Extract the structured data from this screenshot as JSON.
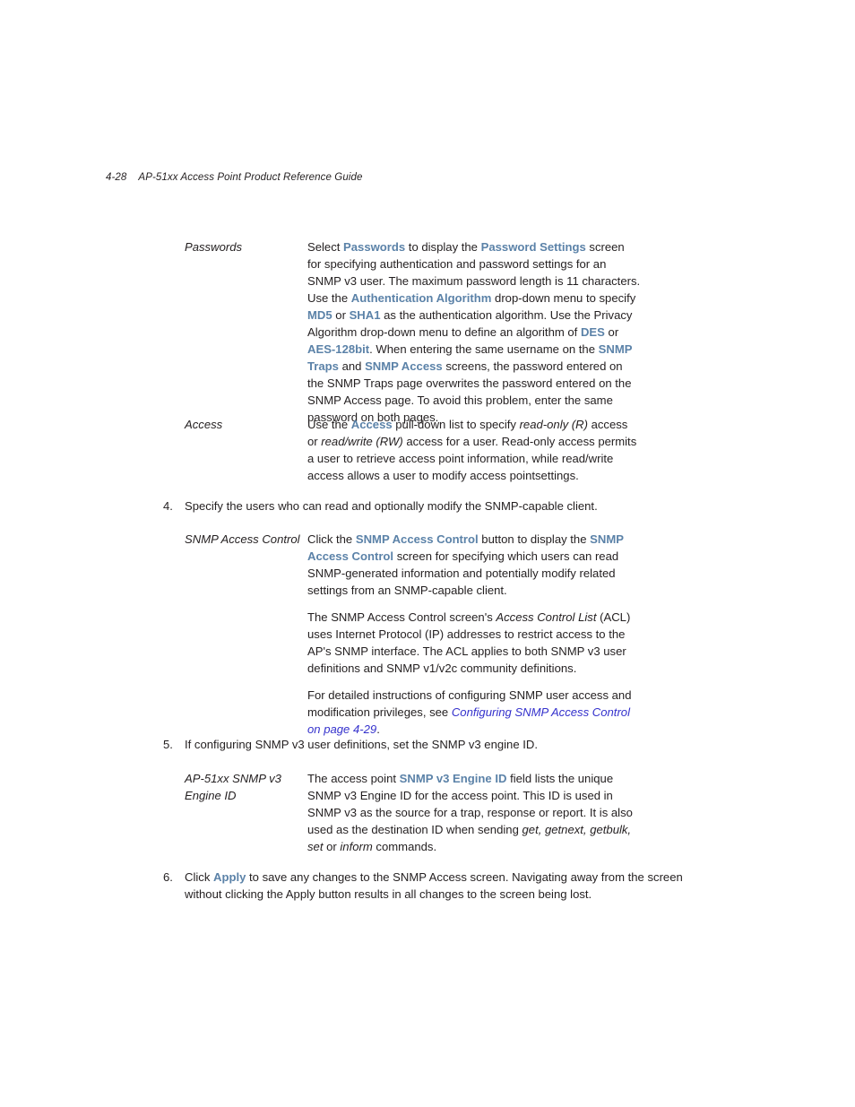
{
  "header": {
    "folio": "4-28",
    "title": "AP-51xx Access Point Product Reference Guide"
  },
  "accent_colors": {
    "ui_term_blue": "#5b82a8",
    "crossref_blue": "#3431cc",
    "body_text": "#231f20",
    "page_background": "#ffffff"
  },
  "definitions": {
    "passwords": {
      "label": "Passwords",
      "paragraph_1": {
        "segments": [
          {
            "text": "Select ",
            "style": "normal"
          },
          {
            "text": "Passwords",
            "style": "ui-bold"
          },
          {
            "text": " to display the ",
            "style": "normal"
          },
          {
            "text": "Password Settings",
            "style": "ui-bold"
          },
          {
            "text": " screen for specifying authentication and password settings for an SNMP v3 user. The maximum password length is 11 characters. Use the ",
            "style": "normal"
          },
          {
            "text": "Authentication Algorithm",
            "style": "ui-bold"
          },
          {
            "text": " drop-down menu to specify ",
            "style": "normal"
          },
          {
            "text": "MD5",
            "style": "ui-bold"
          },
          {
            "text": " or ",
            "style": "normal"
          },
          {
            "text": "SHA1",
            "style": "ui-bold"
          },
          {
            "text": " as the authentication algorithm. Use the Privacy Algorithm drop-down menu to define an algorithm of ",
            "style": "normal"
          },
          {
            "text": "DES",
            "style": "ui-bold"
          },
          {
            "text": " or ",
            "style": "normal"
          },
          {
            "text": "AES-128bit",
            "style": "ui-bold"
          },
          {
            "text": ". When entering the same username on the ",
            "style": "normal"
          },
          {
            "text": "SNMP Traps",
            "style": "ui-bold"
          },
          {
            "text": " and ",
            "style": "normal"
          },
          {
            "text": "SNMP Access",
            "style": "ui-bold"
          },
          {
            "text": " screens, the password entered on the SNMP Traps page overwrites the password entered on the SNMP Access page. To avoid this problem, enter the same password on both pages.",
            "style": "normal"
          }
        ]
      }
    },
    "access": {
      "label": "Access",
      "paragraph_1": {
        "segments": [
          {
            "text": "Use the ",
            "style": "normal"
          },
          {
            "text": "Access",
            "style": "ui-bold"
          },
          {
            "text": " pull-down list to specify ",
            "style": "normal"
          },
          {
            "text": "read-only (R)",
            "style": "italic"
          },
          {
            "text": " access or ",
            "style": "normal"
          },
          {
            "text": "read/write (RW)",
            "style": "italic"
          },
          {
            "text": " access for a user. Read-only access permits a user to retrieve access point information, while read/write access allows a user to modify access pointsettings.",
            "style": "normal"
          }
        ]
      }
    },
    "snmp_access_control": {
      "label": "SNMP Access Control",
      "paragraph_1": {
        "segments": [
          {
            "text": "Click the ",
            "style": "normal"
          },
          {
            "text": "SNMP Access Control",
            "style": "ui-bold"
          },
          {
            "text": " button to display the ",
            "style": "normal"
          },
          {
            "text": "SNMP Access Control",
            "style": "ui-bold"
          },
          {
            "text": " screen for specifying which users can read SNMP-generated information and potentially modify related settings from an SNMP-capable client.",
            "style": "normal"
          }
        ]
      },
      "paragraph_2": {
        "segments": [
          {
            "text": "The SNMP Access Control screen's ",
            "style": "normal"
          },
          {
            "text": "Access Control List",
            "style": "italic"
          },
          {
            "text": " (ACL) uses Internet Protocol (IP) addresses to restrict access to the AP's SNMP interface. The ACL applies to both SNMP v3 user definitions and SNMP v1/v2c community definitions.",
            "style": "normal"
          }
        ]
      },
      "paragraph_3": {
        "segments": [
          {
            "text": "For detailed instructions of configuring SNMP user access and modification privileges, see ",
            "style": "normal"
          },
          {
            "text": "Configuring SNMP Access Control on page 4-29",
            "style": "crossref"
          },
          {
            "text": ".",
            "style": "normal"
          }
        ]
      }
    },
    "engine_id": {
      "label_line_1": "AP-51xx SNMP v3",
      "label_line_2": "Engine ID",
      "paragraph_1": {
        "segments": [
          {
            "text": "The access point ",
            "style": "normal"
          },
          {
            "text": "SNMP v3 Engine ID",
            "style": "ui-bold"
          },
          {
            "text": " field lists the unique SNMP v3 Engine ID for the access point. This ID is used in SNMP v3 as the source for a trap, response or report. It is also used as the destination ID when sending ",
            "style": "normal"
          },
          {
            "text": "get, getnext, getbulk, set",
            "style": "italic"
          },
          {
            "text": " or ",
            "style": "normal"
          },
          {
            "text": "inform",
            "style": "italic"
          },
          {
            "text": " commands.",
            "style": "normal"
          }
        ]
      }
    }
  },
  "steps": [
    {
      "number": "4.",
      "segments": [
        {
          "text": "Specify the users who can read and optionally modify the SNMP-capable client.",
          "style": "normal"
        }
      ]
    },
    {
      "number": "5.",
      "segments": [
        {
          "text": "If configuring SNMP v3 user definitions, set the SNMP v3 engine ID.",
          "style": "normal"
        }
      ]
    },
    {
      "number": "6.",
      "segments": [
        {
          "text": "Click ",
          "style": "normal"
        },
        {
          "text": "Apply",
          "style": "ui-bold"
        },
        {
          "text": " to save any changes to the SNMP Access screen. Navigating away from the screen without clicking the Apply button results in all changes to the screen being lost.",
          "style": "normal"
        }
      ]
    }
  ]
}
